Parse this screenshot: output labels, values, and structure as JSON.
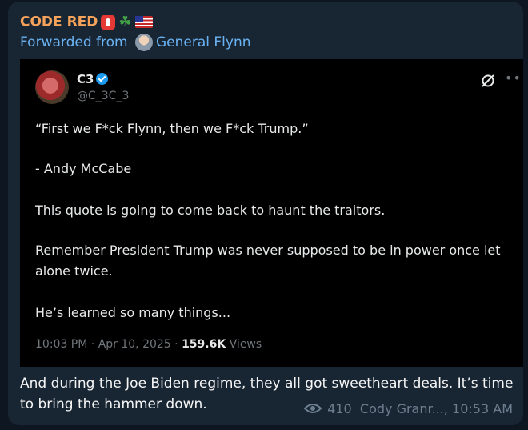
{
  "channel": {
    "name": "CODE RED",
    "emojis": [
      "police-light-icon",
      "shamrock-icon",
      "us-flag-icon"
    ]
  },
  "forward": {
    "label": "Forwarded from",
    "source": "General Flynn"
  },
  "tweet": {
    "author_name": "C3",
    "handle": "@C_3C_3",
    "paragraphs": [
      "“First we F*ck Flynn, then we F*ck Trump.”",
      "- Andy McCabe",
      "This quote is going to come back to haunt the traitors.",
      "Remember President Trump was never supposed to be in power once let alone twice.",
      "He’s learned so many things..."
    ],
    "time": "10:03 PM",
    "date": "Apr 10, 2025",
    "views_count": "159.6K",
    "views_label": "Views"
  },
  "message": {
    "caption": "And during the Joe Biden regime, they all got sweetheart deals. It’s time to bring the hammer down.",
    "view_count": "410",
    "author": "Cody Granr...",
    "time": "10:53 AM"
  },
  "colors": {
    "background": "#0e1621",
    "bubble": "#182533",
    "channel_name": "#f5a35a",
    "link": "#6ab3f3",
    "tweet_bg": "#000000",
    "verified": "#1d9bf0"
  }
}
